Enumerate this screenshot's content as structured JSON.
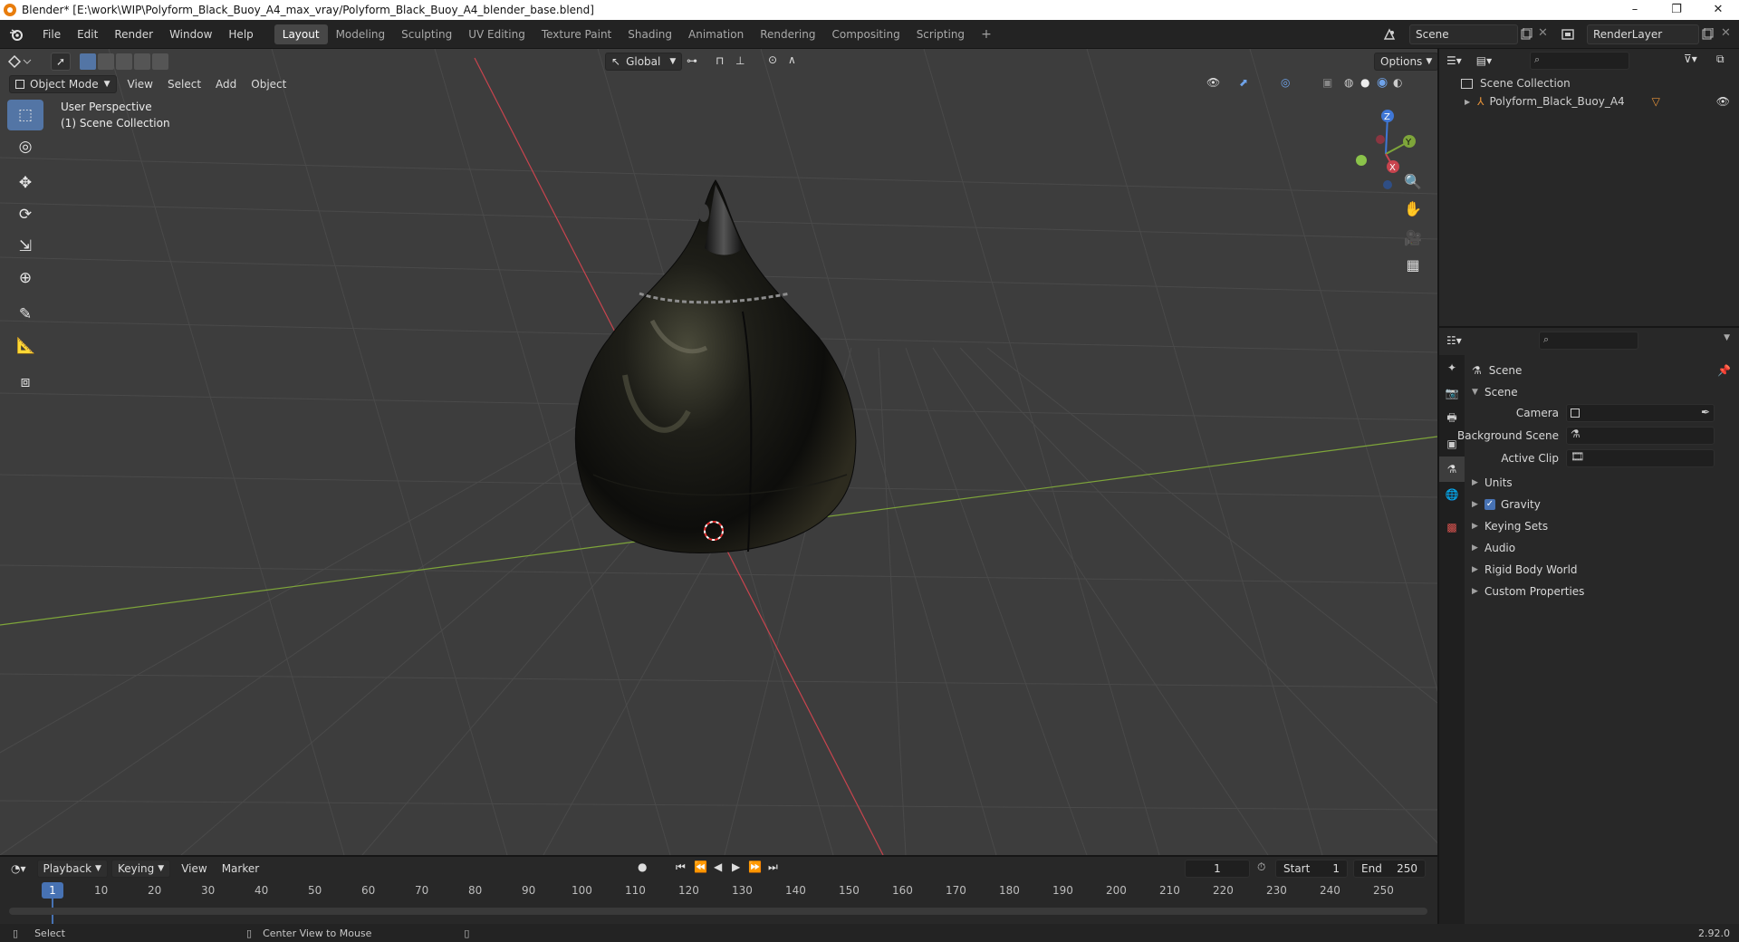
{
  "window": {
    "title": "Blender* [E:\\work\\WIP\\Polyform_Black_Buoy_A4_max_vray/Polyform_Black_Buoy_A4_blender_base.blend]",
    "controls": [
      "–",
      "❐",
      "✕"
    ]
  },
  "topbar": {
    "menus": [
      "File",
      "Edit",
      "Render",
      "Window",
      "Help"
    ],
    "workspaces": [
      "Layout",
      "Modeling",
      "Sculpting",
      "UV Editing",
      "Texture Paint",
      "Shading",
      "Animation",
      "Rendering",
      "Compositing",
      "Scripting"
    ],
    "active_workspace": "Layout",
    "add_workspace": "+",
    "scene_name": "Scene",
    "view_layer": "RenderLayer"
  },
  "viewport": {
    "mode": "Object Mode",
    "menus": [
      "View",
      "Select",
      "Add",
      "Object"
    ],
    "transform_orientation": "Global",
    "options_label": "Options",
    "overlay_line1": "User Perspective",
    "overlay_line2": "(1) Scene Collection",
    "gizmo_axes": [
      "X",
      "Y",
      "Z"
    ]
  },
  "outliner": {
    "root": "Scene Collection",
    "items": [
      {
        "name": "Polyform_Black_Buoy_A4",
        "visible": true
      }
    ]
  },
  "properties": {
    "context_title": "Scene",
    "panel_title": "Scene",
    "fields": [
      {
        "label": "Camera",
        "value": ""
      },
      {
        "label": "Background Scene",
        "value": ""
      },
      {
        "label": "Active Clip",
        "value": ""
      }
    ],
    "subpanels": [
      {
        "label": "Units",
        "checkbox": false
      },
      {
        "label": "Gravity",
        "checkbox": true,
        "checked": true
      },
      {
        "label": "Keying Sets",
        "checkbox": false
      },
      {
        "label": "Audio",
        "checkbox": false
      },
      {
        "label": "Rigid Body World",
        "checkbox": false
      },
      {
        "label": "Custom Properties",
        "checkbox": false
      }
    ]
  },
  "timeline": {
    "menus": [
      "Playback",
      "Keying",
      "View",
      "Marker"
    ],
    "current_frame": "1",
    "start_label": "Start",
    "start": "1",
    "end_label": "End",
    "end": "250",
    "ticks": [
      "1",
      "10",
      "20",
      "30",
      "40",
      "50",
      "60",
      "70",
      "80",
      "90",
      "100",
      "110",
      "120",
      "130",
      "140",
      "150",
      "160",
      "170",
      "180",
      "190",
      "200",
      "210",
      "220",
      "230",
      "240",
      "250"
    ]
  },
  "statusbar": {
    "left_action": "Select",
    "middle_action": "Center View to Mouse",
    "version": "2.92.0"
  },
  "colors": {
    "accent": "#5375a5",
    "active_frame": "#4772b3",
    "x_axis": "#c8444e",
    "y_axis": "#7ea53a",
    "z_axis": "#3f77d6"
  }
}
